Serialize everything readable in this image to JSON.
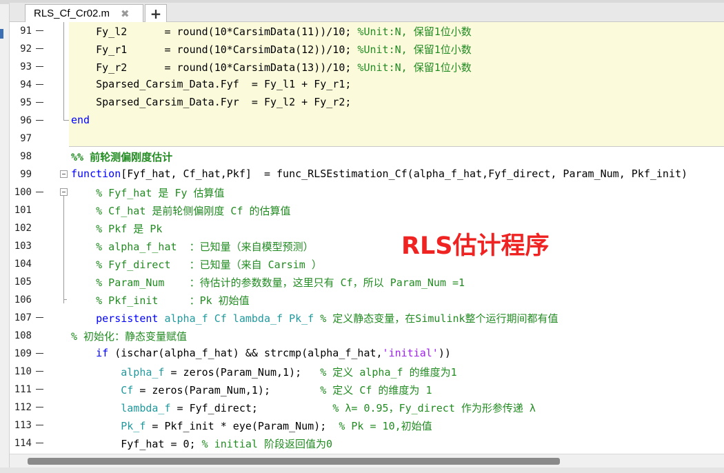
{
  "tab": {
    "filename": "RLS_Cf_Cr02.m",
    "close_glyph": "✖",
    "add_glyph": "+"
  },
  "overlay_text": "RLS估计程序",
  "lines": [
    {
      "n": "91",
      "dash": true,
      "segs": [
        {
          "t": "    Fy_l2      = round(10*CarsimData(11))/10; "
        },
        {
          "t": "%Unit:N, 保留1位小数",
          "c": "cm"
        }
      ]
    },
    {
      "n": "92",
      "dash": true,
      "segs": [
        {
          "t": "    Fy_r1      = round(10*CarsimData(12))/10; "
        },
        {
          "t": "%Unit:N, 保留1位小数",
          "c": "cm"
        }
      ]
    },
    {
      "n": "93",
      "dash": true,
      "segs": [
        {
          "t": "    Fy_r2      = round(10*CarsimData(13))/10; "
        },
        {
          "t": "%Unit:N, 保留1位小数",
          "c": "cm"
        }
      ]
    },
    {
      "n": "94",
      "dash": true,
      "segs": [
        {
          "t": "    Sparsed_Carsim_Data.Fyf  = Fy_l1 + Fy_r1;"
        }
      ]
    },
    {
      "n": "95",
      "dash": true,
      "segs": [
        {
          "t": "    Sparsed_Carsim_Data.Fyr  = Fy_l2 + Fy_r2;"
        }
      ]
    },
    {
      "n": "96",
      "dash": true,
      "segs": [
        {
          "t": "end",
          "c": "kw"
        }
      ]
    },
    {
      "n": "97",
      "dash": false,
      "segs": [
        {
          "t": ""
        }
      ]
    },
    {
      "n": "98",
      "dash": false,
      "segs": [
        {
          "t": "%% 前轮测偏刚度估计",
          "c": "cm bold"
        }
      ]
    },
    {
      "n": "99",
      "dash": false,
      "segs": [
        {
          "t": "function",
          "c": "kw"
        },
        {
          "t": "[Fyf_hat, Cf_hat,Pkf]  = func_RLSEstimation_Cf(alpha_f_hat,Fyf_direct, Param_Num, Pkf_init)"
        }
      ]
    },
    {
      "n": "100",
      "dash": true,
      "segs": [
        {
          "t": "    % Fyf_hat 是 Fy 估算值",
          "c": "cm"
        }
      ]
    },
    {
      "n": "101",
      "dash": false,
      "segs": [
        {
          "t": "    % Cf_hat 是前轮侧偏刚度 Cf 的估算值",
          "c": "cm"
        }
      ]
    },
    {
      "n": "102",
      "dash": false,
      "segs": [
        {
          "t": "    % Pkf 是 Pk",
          "c": "cm"
        }
      ]
    },
    {
      "n": "103",
      "dash": false,
      "segs": [
        {
          "t": "    % alpha_f_hat  ：已知量（来自模型预测）",
          "c": "cm"
        }
      ]
    },
    {
      "n": "104",
      "dash": false,
      "segs": [
        {
          "t": "    % Fyf_direct   ：已知量（来自 Carsim ）",
          "c": "cm"
        }
      ]
    },
    {
      "n": "105",
      "dash": false,
      "segs": [
        {
          "t": "    % Param_Num    ：待估计的参数数量，这里只有 Cf，所以 Param_Num =1",
          "c": "cm"
        }
      ]
    },
    {
      "n": "106",
      "dash": false,
      "segs": [
        {
          "t": "    % Pkf_init     ：Pk 初始值",
          "c": "cm"
        }
      ]
    },
    {
      "n": "107",
      "dash": true,
      "segs": [
        {
          "t": "    "
        },
        {
          "t": "persistent",
          "c": "kw"
        },
        {
          "t": " alpha_f Cf lambda_f Pk_f",
          "c": "pv"
        },
        {
          "t": " % 定义静态变量，在Simulink整个运行期间都有值",
          "c": "cm"
        }
      ]
    },
    {
      "n": "108",
      "dash": false,
      "segs": [
        {
          "t": "% 初始化：静态变量赋值",
          "c": "cm"
        }
      ]
    },
    {
      "n": "109",
      "dash": true,
      "segs": [
        {
          "t": "    "
        },
        {
          "t": "if",
          "c": "kw"
        },
        {
          "t": " (ischar(alpha_f_hat) && strcmp(alpha_f_hat,"
        },
        {
          "t": "'initial'",
          "c": "st"
        },
        {
          "t": "))"
        }
      ]
    },
    {
      "n": "110",
      "dash": true,
      "segs": [
        {
          "t": "        "
        },
        {
          "t": "alpha_f",
          "c": "pv"
        },
        {
          "t": " = zeros(Param_Num,1);   "
        },
        {
          "t": "% 定义 alpha_f 的维度为1",
          "c": "cm"
        }
      ]
    },
    {
      "n": "111",
      "dash": true,
      "segs": [
        {
          "t": "        "
        },
        {
          "t": "Cf",
          "c": "pv"
        },
        {
          "t": " = zeros(Param_Num,1);        "
        },
        {
          "t": "% 定义 Cf 的维度为 1",
          "c": "cm"
        }
      ]
    },
    {
      "n": "112",
      "dash": true,
      "segs": [
        {
          "t": "        "
        },
        {
          "t": "lambda_f",
          "c": "pv"
        },
        {
          "t": " = Fyf_direct;            "
        },
        {
          "t": "% λ= 0.95，Fy_direct 作为形参传递 λ",
          "c": "cm"
        }
      ]
    },
    {
      "n": "113",
      "dash": true,
      "segs": [
        {
          "t": "        "
        },
        {
          "t": "Pk_f",
          "c": "pv"
        },
        {
          "t": " = Pkf_init * eye(Param_Num);  "
        },
        {
          "t": "% Pk = 10,初始值",
          "c": "cm"
        }
      ]
    },
    {
      "n": "114",
      "dash": true,
      "segs": [
        {
          "t": "        Fyf_hat = 0; "
        },
        {
          "t": "% initial 阶段返回值为0",
          "c": "cm"
        }
      ]
    }
  ]
}
